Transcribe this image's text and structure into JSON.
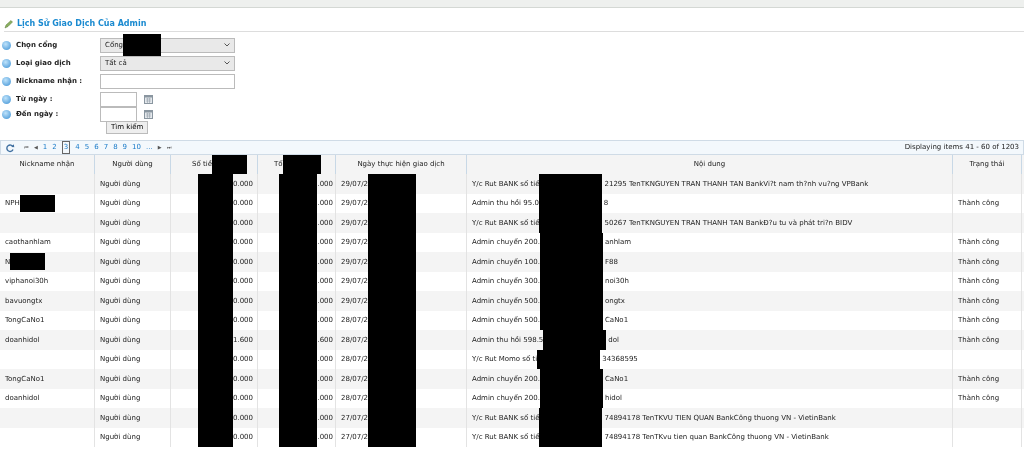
{
  "title": "Lịch Sử Giao Dịch Của Admin",
  "form": {
    "fields": [
      {
        "kind": "select",
        "label": "Chọn cổng",
        "value": "Cổng",
        "redacted": true
      },
      {
        "kind": "select",
        "label": "Loại giao dịch",
        "value": "Tất cả"
      },
      {
        "kind": "text",
        "label": "Nickname nhận :"
      },
      {
        "kind": "date",
        "label": "Từ ngày :"
      },
      {
        "kind": "date",
        "label": "Đến ngày :"
      }
    ],
    "search_button": "Tìm kiếm"
  },
  "pager": {
    "first": "⏮",
    "prev": "◀",
    "pages": [
      {
        "label": "1",
        "selected": false
      },
      {
        "label": "2",
        "selected": false
      },
      {
        "label": "3",
        "selected": true
      },
      {
        "label": "4",
        "selected": false
      },
      {
        "label": "5",
        "selected": false
      },
      {
        "label": "6",
        "selected": false
      },
      {
        "label": "7",
        "selected": false
      },
      {
        "label": "8",
        "selected": false
      },
      {
        "label": "9",
        "selected": false
      },
      {
        "label": "10",
        "selected": false
      },
      {
        "label": "...",
        "selected": false
      }
    ],
    "next": "▶",
    "last": "⏭",
    "summary": "Displaying items 41 - 60 of 1203"
  },
  "table": {
    "columns": [
      "Nickname nhận",
      "Người dùng",
      "Số tiề",
      "Tổ",
      "Ngày thực hiện giao dịch",
      "Nội dung",
      "Trạng thái"
    ],
    "rows": [
      {
        "nickname": "",
        "nickname_redacted": false,
        "user": "Người dùng",
        "amount": "0.000",
        "fee": ".000",
        "date": "29/07/2",
        "content_start": "Y/c Rut BANK số tiề",
        "content_end": "21295 TenTKNGUYEN TRAN THANH TAN BankVi?t nam th?nh vu?ng VPBank",
        "status": ""
      },
      {
        "nickname": "NPH",
        "nickname_redacted": true,
        "user": "Người dùng",
        "amount": "0.000",
        "fee": ".000",
        "date": "29/07/2",
        "content_start": "Admin thu hồi 95.0",
        "content_end": "8",
        "status": "Thành công"
      },
      {
        "nickname": "",
        "nickname_redacted": false,
        "user": "Người dùng",
        "amount": "0.000",
        "fee": ".000",
        "date": "29/07/2",
        "content_start": "Y/c Rut BANK số tiề",
        "content_end": "50267 TenTKNGUYEN TRAN THANH TAN BankĐ?u tu và phát tri?n BIDV",
        "status": ""
      },
      {
        "nickname": "caothanhlam",
        "nickname_redacted": false,
        "user": "Người dùng",
        "amount": "0.000",
        "fee": ".000",
        "date": "29/07/2",
        "content_start": "Admin chuyển 200.",
        "content_end": "anhlam",
        "status": "Thành công"
      },
      {
        "nickname": "N",
        "nickname_redacted": true,
        "user": "Người dùng",
        "amount": "0.000",
        "fee": ".000",
        "date": "29/07/2",
        "content_start": "Admin chuyển 100.",
        "content_end": "F88",
        "status": "Thành công"
      },
      {
        "nickname": "viphanoi30h",
        "nickname_redacted": false,
        "user": "Người dùng",
        "amount": "0.000",
        "fee": ".000",
        "date": "29/07/2",
        "content_start": "Admin chuyển 300.",
        "content_end": "noi30h",
        "status": "Thành công"
      },
      {
        "nickname": "bavuongtx",
        "nickname_redacted": false,
        "user": "Người dùng",
        "amount": "0.000",
        "fee": ".000",
        "date": "29/07/2",
        "content_start": "Admin chuyển 500.",
        "content_end": "ongtx",
        "status": "Thành công"
      },
      {
        "nickname": "TongCaNo1",
        "nickname_redacted": false,
        "user": "Người dùng",
        "amount": "0.000",
        "fee": ".000",
        "date": "28/07/2",
        "content_start": "Admin chuyển 500.",
        "content_end": "CaNo1",
        "status": "Thành công"
      },
      {
        "nickname": "doanhidol",
        "nickname_redacted": false,
        "user": "Người dùng",
        "amount": "1.600",
        "fee": ".600",
        "date": "28/07/2",
        "content_start": "Admin thu hồi 598.5",
        "content_end": "dol",
        "status": "Thành công"
      },
      {
        "nickname": "",
        "nickname_redacted": false,
        "user": "Người dùng",
        "amount": "0.000",
        "fee": ".000",
        "date": "28/07/2",
        "content_start": "Y/c Rut Momo số ti",
        "content_end": "34368595",
        "status": ""
      },
      {
        "nickname": "TongCaNo1",
        "nickname_redacted": false,
        "user": "Người dùng",
        "amount": "0.000",
        "fee": ".000",
        "date": "28/07/2",
        "content_start": "Admin chuyển 200.",
        "content_end": "CaNo1",
        "status": "Thành công"
      },
      {
        "nickname": "doanhidol",
        "nickname_redacted": false,
        "user": "Người dùng",
        "amount": "0.000",
        "fee": ".000",
        "date": "28/07/2",
        "content_start": "Admin chuyển 200.",
        "content_end": "hidol",
        "status": "Thành công"
      },
      {
        "nickname": "",
        "nickname_redacted": false,
        "user": "Người dùng",
        "amount": "0.000",
        "fee": ".000",
        "date": "27/07/2",
        "content_start": "Y/c Rut BANK số tiề",
        "content_end": "74894178 TenTKVU TIEN QUAN BankCông thuong VN - VietinBank",
        "status": ""
      },
      {
        "nickname": "",
        "nickname_redacted": false,
        "user": "Người dùng",
        "amount": "0.000",
        "fee": ".000",
        "date": "27/07/2",
        "content_start": "Y/c Rut BANK số tiề",
        "content_end": "74894178 TenTKvu tien quan BankCông thuong VN - VietinBank",
        "status": ""
      }
    ]
  }
}
